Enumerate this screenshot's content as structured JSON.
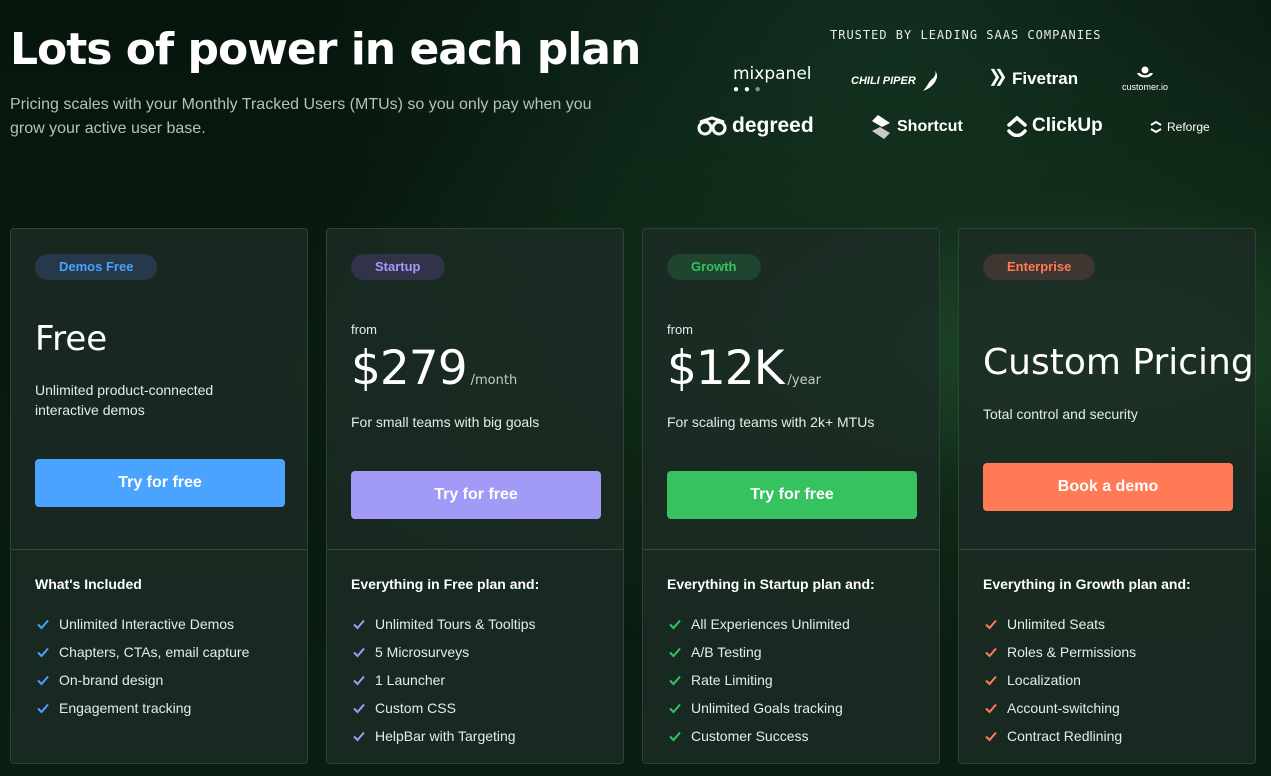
{
  "hero": {
    "title": "Lots of power in each plan",
    "subtitle": "Pricing scales with your Monthly Tracked Users (MTUs) so you only pay when you grow your active user base."
  },
  "trusted": {
    "title": "TRUSTED BY LEADING SAAS COMPANIES",
    "logos": [
      "mixpanel",
      "CHILI PIPER",
      "Fivetran",
      "customer.io",
      "degreed",
      "Shortcut",
      "ClickUp",
      "Reforge"
    ]
  },
  "plans": [
    {
      "badge": "Demos Free",
      "accent": "#4aa3ff",
      "badge_bg": "#26394a",
      "from": "",
      "price": "Free",
      "per": "",
      "description": "Unlimited product-connected interactive demos",
      "cta": "Try for free",
      "features_title": "What's Included",
      "features": [
        "Unlimited Interactive Demos",
        "Chapters, CTAs, email capture",
        "On-brand design",
        "Engagement tracking"
      ]
    },
    {
      "badge": "Startup",
      "accent": "#a29af7",
      "badge_bg": "#30334a",
      "from": "from",
      "price": "$279",
      "per": "/month",
      "description": "For small teams with big goals",
      "cta": "Try for free",
      "features_title": "Everything in Free plan and:",
      "features": [
        "Unlimited Tours & Tooltips",
        "5 Microsurveys",
        "1 Launcher",
        "Custom CSS",
        "HelpBar with Targeting"
      ]
    },
    {
      "badge": "Growth",
      "accent": "#35c25f",
      "badge_bg": "#1f4430",
      "from": "from",
      "price": "$12K",
      "per": "/year",
      "description": "For scaling teams with 2k+ MTUs",
      "cta": "Try for free",
      "features_title": "Everything in Startup plan and:",
      "features": [
        "All Experiences Unlimited",
        "A/B Testing",
        "Rate Limiting",
        "Unlimited Goals tracking",
        "Customer Success"
      ]
    },
    {
      "badge": "Enterprise",
      "accent": "#ff7a55",
      "badge_bg": "#3e3630",
      "from": "",
      "price": "Custom Pricing",
      "per": "",
      "description": "Total control and security",
      "cta": "Book a demo",
      "features_title": "Everything in Growth plan and:",
      "features": [
        "Unlimited Seats",
        "Roles & Permissions",
        "Localization",
        "Account-switching",
        "Contract Redlining"
      ]
    }
  ]
}
